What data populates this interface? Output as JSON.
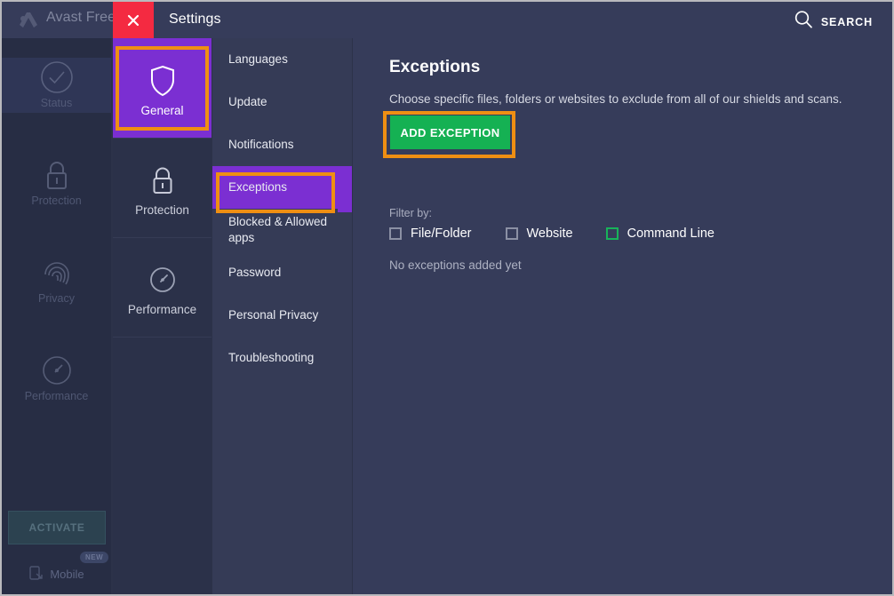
{
  "background_app": {
    "title": "Avast Free A",
    "logo_icon": "avast-logo-icon",
    "nav_items": [
      {
        "label": "Status",
        "icon": "check-circle-icon",
        "active": true
      },
      {
        "label": "Protection",
        "icon": "lock-icon",
        "active": false
      },
      {
        "label": "Privacy",
        "icon": "fingerprint-icon",
        "active": false
      },
      {
        "label": "Performance",
        "icon": "speedometer-icon",
        "active": false
      }
    ],
    "activate_button": "ACTIVATE",
    "new_badge": "NEW",
    "mobile_label": "Mobile",
    "mobile_icon": "mobile-device-icon"
  },
  "dialog": {
    "title": "Settings",
    "close_icon": "close-x-icon",
    "close_button_color": "#f42a41",
    "search": {
      "label": "SEARCH",
      "icon": "search-icon"
    },
    "categories": [
      {
        "label": "General",
        "icon": "shield-icon",
        "selected": true
      },
      {
        "label": "Protection",
        "icon": "lock-icon",
        "selected": false
      },
      {
        "label": "Performance",
        "icon": "speedometer-icon",
        "selected": false
      }
    ],
    "subnav": [
      {
        "label": "Languages",
        "selected": false
      },
      {
        "label": "Update",
        "selected": false
      },
      {
        "label": "Notifications",
        "selected": false
      },
      {
        "label": "Exceptions",
        "selected": true
      },
      {
        "label": "Blocked & Allowed apps",
        "selected": false
      },
      {
        "label": "Password",
        "selected": false
      },
      {
        "label": "Personal Privacy",
        "selected": false
      },
      {
        "label": "Troubleshooting",
        "selected": false
      }
    ]
  },
  "content": {
    "heading": "Exceptions",
    "description": "Choose specific files, folders or websites to exclude from all of our shields and scans.",
    "add_button": "ADD EXCEPTION",
    "add_button_color": "#15b153",
    "filter_label": "Filter by:",
    "filters": [
      {
        "label": "File/Folder",
        "checked": false,
        "accent": "#8b90a4"
      },
      {
        "label": "Website",
        "checked": false,
        "accent": "#8b90a4"
      },
      {
        "label": "Command Line",
        "checked": false,
        "accent": "#18b35a"
      }
    ],
    "empty_message": "No exceptions added yet"
  },
  "annotations": {
    "color": "#ef8f13",
    "boxes": [
      "general-category",
      "exceptions-subnav-item",
      "add-exception-button"
    ]
  },
  "theme": {
    "accent_purple": "#7b2fd2",
    "panel_bg": "#363c5a",
    "subnav_bg": "#353b56",
    "category_bg": "#2b3149"
  }
}
